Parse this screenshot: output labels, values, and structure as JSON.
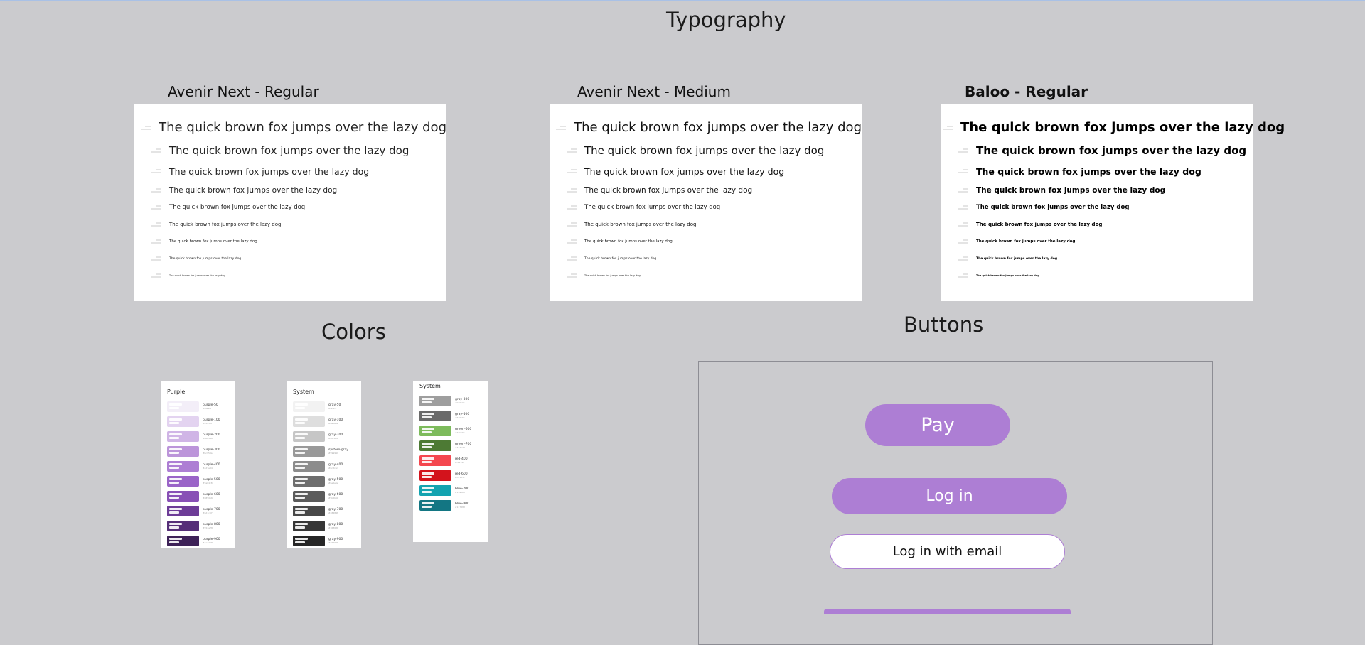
{
  "sections": {
    "typography": "Typography",
    "colors": "Colors",
    "buttons": "Buttons"
  },
  "typography": {
    "sample_text": "The quick brown fox jumps over the lazy dog",
    "fonts": [
      {
        "title": "Avenir Next - Regular",
        "style": "regular"
      },
      {
        "title": "Avenir Next - Medium",
        "style": "medium"
      },
      {
        "title": "Baloo - Regular",
        "style": "baloo"
      }
    ]
  },
  "colors": {
    "cards": [
      {
        "title": "Purple",
        "swatches": [
          {
            "name": "purple-50",
            "hex": "#f3eef8"
          },
          {
            "name": "purple-100",
            "hex": "#e3d3f0"
          },
          {
            "name": "purple-200",
            "hex": "#d0b5e6"
          },
          {
            "name": "purple-300",
            "hex": "#bc95da"
          },
          {
            "name": "purple-400",
            "hex": "#ad7ed4"
          },
          {
            "name": "purple-500",
            "hex": "#9a64c8"
          },
          {
            "name": "purple-600",
            "hex": "#8850b6"
          },
          {
            "name": "purple-700",
            "hex": "#6d3c97"
          },
          {
            "name": "purple-800",
            "hex": "#552e78"
          },
          {
            "name": "purple-900",
            "hex": "#3e2258"
          }
        ]
      },
      {
        "title": "System",
        "swatches": [
          {
            "name": "gray-50",
            "hex": "#f2f2f2"
          },
          {
            "name": "gray-100",
            "hex": "#dedede"
          },
          {
            "name": "gray-200",
            "hex": "#c6c6c6"
          },
          {
            "name": "system-gray",
            "hex": "#999999"
          },
          {
            "name": "gray-400",
            "hex": "#8c8c8c"
          },
          {
            "name": "gray-500",
            "hex": "#6e6e6e"
          },
          {
            "name": "gray-600",
            "hex": "#5b5b5b"
          },
          {
            "name": "gray-700",
            "hex": "#484848"
          },
          {
            "name": "gray-800",
            "hex": "#363636"
          },
          {
            "name": "gray-900",
            "hex": "#262626"
          }
        ]
      },
      {
        "title": "System",
        "swatches": [
          {
            "name": "gray-300",
            "hex": "#9e9e9e"
          },
          {
            "name": "gray-500",
            "hex": "#6a6a6a"
          },
          {
            "name": "green-600",
            "hex": "#7dbb5c"
          },
          {
            "name": "green-700",
            "hex": "#4d7a34"
          },
          {
            "name": "red-400",
            "hex": "#f4474f"
          },
          {
            "name": "red-600",
            "hex": "#d3131c"
          },
          {
            "name": "blue-700",
            "hex": "#13a3b0"
          },
          {
            "name": "blue-800",
            "hex": "#137683"
          }
        ]
      }
    ]
  },
  "buttons": {
    "pay": "Pay",
    "login": "Log in",
    "login_email": "Log in with email"
  },
  "palette": {
    "background": "#cbcbce",
    "primary": "#ad7ed4",
    "card": "#ffffff"
  }
}
